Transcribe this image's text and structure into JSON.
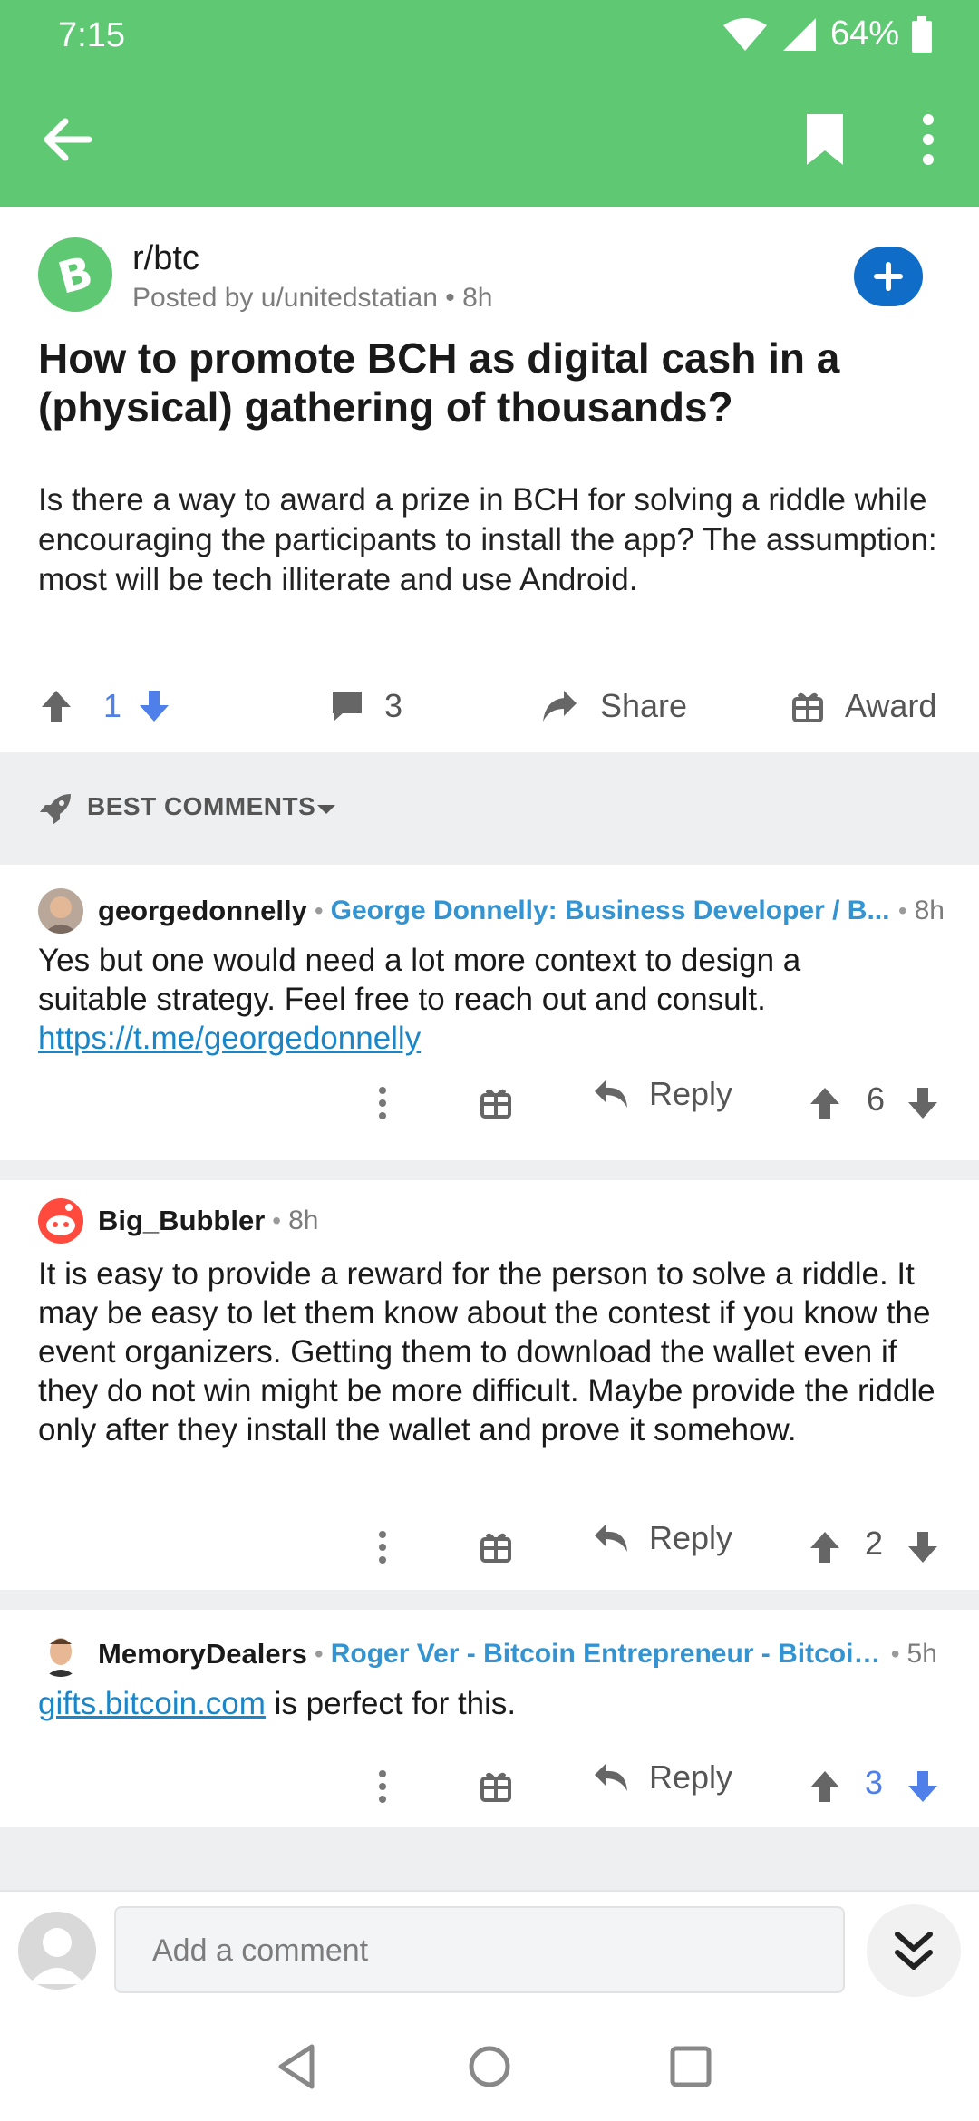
{
  "status_bar": {
    "time": "7:15",
    "battery": "64%"
  },
  "post": {
    "subreddit": "r/btc",
    "posted_by": "Posted by u/unitedstatian",
    "age": "8h",
    "title": "How to promote BCH as digital cash in a (physical) gathering of thousands?",
    "body": "Is there a way to award a prize in BCH for solving a riddle while encouraging the participants to install the app? The assumption: most will be tech illiterate and use Android.",
    "score": "1",
    "comment_count": "3",
    "share_label": "Share",
    "award_label": "Award"
  },
  "sort": {
    "label": "BEST COMMENTS"
  },
  "comments": [
    {
      "username": "georgedonnelly",
      "flair": "George Donnelly: Business Developer / B...",
      "age": "8h",
      "body_text": "Yes but one would need a lot more context to design a suitable strategy. Feel free to reach out and consult.",
      "link": "https://t.me/georgedonnelly",
      "reply_label": "Reply",
      "score": "6"
    },
    {
      "username": "Big_Bubbler",
      "age": "8h",
      "body_text": "It is easy to provide a reward for the person to solve a riddle. It may be easy to let them know about the contest if you know the event organizers. Getting them to download the wallet even if they do not win might be more difficult. Maybe provide the riddle only after they install the wallet and prove it somehow.",
      "reply_label": "Reply",
      "score": "2"
    },
    {
      "username": "MemoryDealers",
      "flair": "Roger Ver - Bitcoin Entrepreneur - Bitcoin...",
      "age": "5h",
      "link": "gifts.bitcoin.com",
      "body_text": " is perfect for this.",
      "reply_label": "Reply",
      "score": "3"
    }
  ],
  "composer": {
    "placeholder": "Add a comment"
  },
  "colors": {
    "accent_green": "#5ec873",
    "upvote_blue": "#4f7fe8",
    "flair_blue": "#3493d1"
  }
}
